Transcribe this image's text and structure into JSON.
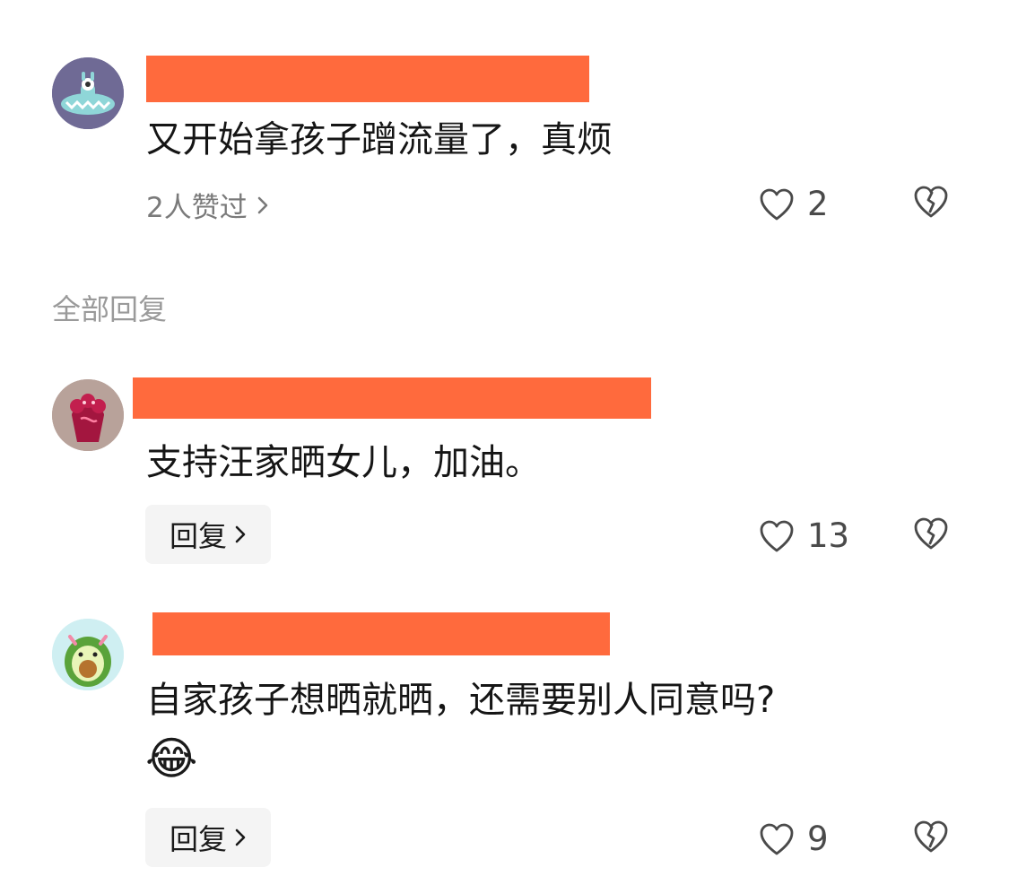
{
  "section_label": "全部回复",
  "comments": [
    {
      "text": "又开始拿孩子蹭流量了，真烦",
      "likes_summary": "2人赞过",
      "like_count": "2"
    },
    {
      "text": "支持汪家晒女儿，加油。",
      "reply_label": "回复",
      "like_count": "13"
    },
    {
      "text": "自家孩子想晒就晒，还需要别人同意吗?",
      "emoji": "😂",
      "reply_label": "回复",
      "like_count": "9"
    }
  ],
  "colors": {
    "redaction": "#ff6a3d",
    "avatar1_bg": "#6f6a95",
    "avatar2_bg": "#b8a29a",
    "avatar3_bg": "#cfeff2"
  },
  "icons": {
    "like": "heart-outline-icon",
    "dislike": "broken-heart-icon",
    "chevron": "chevron-right-icon"
  }
}
